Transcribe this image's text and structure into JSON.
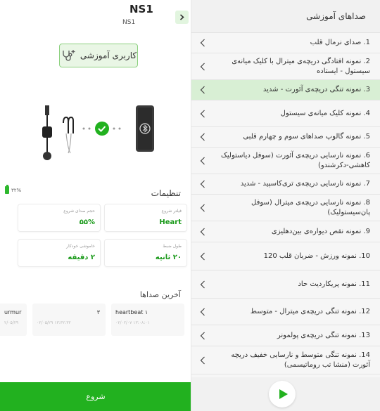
{
  "device": {
    "title": "NS1",
    "subtitle": "NS1",
    "tutor_label": "کاربری آموزشی"
  },
  "battery": {
    "text": "۳۲%",
    "color": "#2eb82e"
  },
  "settings": {
    "title": "تنظیمات",
    "cards": [
      {
        "label": "فیلتر شروع",
        "value": "Heart"
      },
      {
        "label": "حجم صدای شروع",
        "value": "۵۵%"
      },
      {
        "label": "طول ضبط",
        "value": "۲۰ ثانیه"
      },
      {
        "label": "خاموشی خودکار",
        "value": "۲ دقیقه"
      }
    ]
  },
  "recent": {
    "title": "آخرین صداها",
    "items": [
      {
        "name": "heartbeat ۱",
        "date": "۰۲/۰۲/۰۷ ۱۳:۰۸:۰۱",
        "num": ""
      },
      {
        "name": "",
        "date": "۰۲/۰۵/۲۹ ۱۳:۳۲:۳۲",
        "num": "۳"
      },
      {
        "name": "urmur",
        "date": "۲/۰۵/۲۹",
        "num": ""
      }
    ]
  },
  "start_label": "شروع",
  "list": {
    "title": "صداهای آموزشی",
    "active_index": 2,
    "items": [
      "1. صدای نرمال قلب",
      "2. نمونه افتادگی دریچه‌ی میترال با کلیک میانه‌ی سیستول - ایستاده",
      "3. نمونه تنگی دریچه‌ی آئورت - شدید",
      "4. نمونه کلیک میانه‌ی سیستول",
      "5. نمونه گالوپ صداهای سوم و چهارم قلبی",
      "6. نمونه نارسایی دریچه‌ی آئورت (سوفل دیاستولیک کاهشی-دکرشندو)",
      "7. نمونه نارسایی دریچه‌ی تری‌کاسپید - شدید",
      "8. نمونه نارسایی دریچه‌ی میترال (سوفل پان‌سیستولیک)",
      "9. نمونه نقص دیواره‌ی بین‌دهلیزی",
      "10. نمونه ورزش - ضربان قلب 120",
      "11. نمونه پریکاردیت حاد",
      "12. نمونه تنگی دریچه‌ی میترال - متوسط",
      "13. نمونه تنگی دریچه‌ی پولمونر",
      "14. نمونه تنگی متوسط و نارسایی خفیف دریچه آئورت (منشا تب روماتیسمی)"
    ]
  },
  "colors": {
    "accent": "#22b11f",
    "active_row": "#d8efd4"
  }
}
